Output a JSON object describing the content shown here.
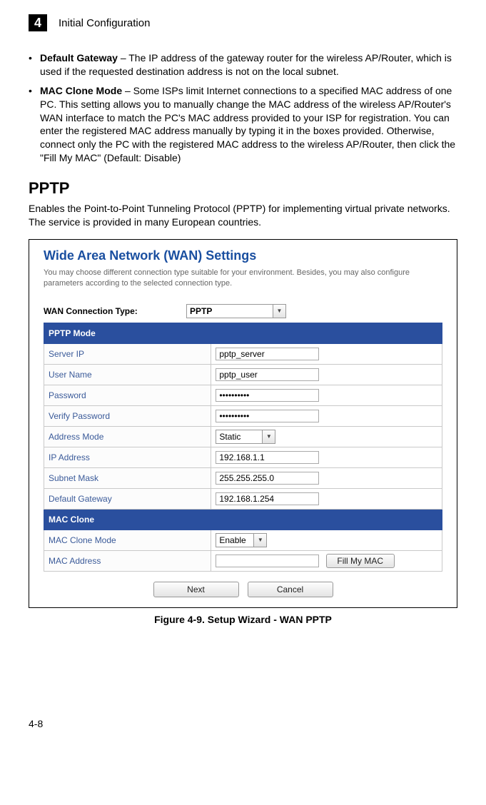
{
  "header": {
    "chapter_num": "4",
    "chapter_title": "Initial Configuration"
  },
  "bullets": {
    "b1": {
      "label": "Default Gateway",
      "text": " – The IP address of the gateway router for the wireless AP/Router, which is used if the requested destination address is not on the local subnet."
    },
    "b2": {
      "label": "MAC Clone Mode",
      "text": " – Some ISPs limit Internet connections to a specified MAC address of one PC. This setting allows you to manually change the MAC address of the wireless AP/Router's WAN interface to match the PC's MAC address provided to your ISP for registration. You can enter the registered MAC address manually by typing it in the boxes provided. Otherwise, connect only the PC with the registered MAC address to the wireless AP/Router, then click the \"Fill My MAC\" (Default: Disable)"
    }
  },
  "section": {
    "heading": "PPTP",
    "para": "Enables the Point-to-Point Tunneling Protocol (PPTP) for implementing virtual private networks. The service is provided in many European countries."
  },
  "wan": {
    "title": "Wide Area Network (WAN) Settings",
    "desc": "You may choose different connection type suitable for your environment. Besides, you may also configure parameters according to the selected connection type.",
    "conn_label": "WAN Connection Type:",
    "conn_value": "PPTP",
    "sections": {
      "pptp": "PPTP Mode",
      "mac": "MAC Clone"
    },
    "rows": {
      "server_ip": {
        "label": "Server IP",
        "value": "pptp_server"
      },
      "user_name": {
        "label": "User Name",
        "value": "pptp_user"
      },
      "password": {
        "label": "Password",
        "value": "••••••••••"
      },
      "verify_password": {
        "label": "Verify Password",
        "value": "••••••••••"
      },
      "address_mode": {
        "label": "Address Mode",
        "value": "Static"
      },
      "ip_address": {
        "label": "IP Address",
        "value": "192.168.1.1"
      },
      "subnet_mask": {
        "label": "Subnet Mask",
        "value": "255.255.255.0"
      },
      "default_gateway": {
        "label": "Default Gateway",
        "value": "192.168.1.254"
      },
      "mac_clone_mode": {
        "label": "MAC Clone Mode",
        "value": "Enable"
      },
      "mac_address": {
        "label": "MAC Address",
        "value": ""
      }
    },
    "buttons": {
      "fill_mac": "Fill My MAC",
      "next": "Next",
      "cancel": "Cancel"
    }
  },
  "figure_caption": "Figure 4-9.   Setup Wizard - WAN PPTP",
  "footer": "4-8"
}
